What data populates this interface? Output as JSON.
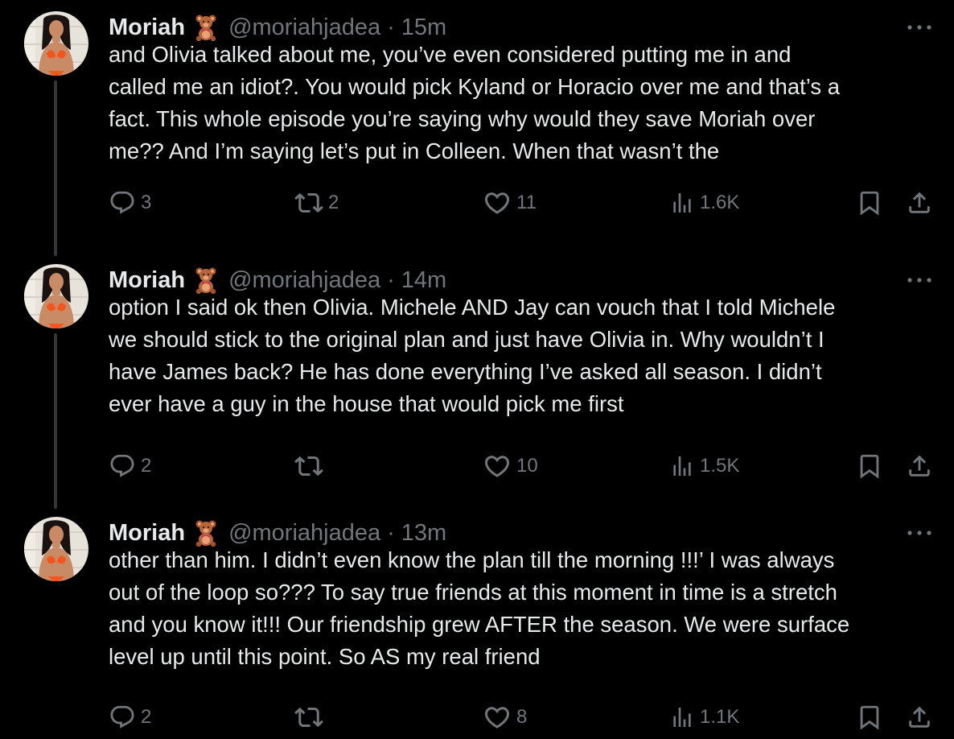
{
  "tweets": [
    {
      "name": "Moriah",
      "handle": "@moriahjadea",
      "separator": "·",
      "time": "15m",
      "text": "and Olivia talked about me, you’ve even considered putting me in and\ncalled me an idiot?. You would pick Kyland or Horacio over me and that’s a\nfact. This whole episode you’re saying why would they save Moriah over\nme?? And I’m saying let’s put in Colleen. When that wasn’t the",
      "replies": "3",
      "reposts": "2",
      "likes": "11",
      "views": "1.6K"
    },
    {
      "name": "Moriah",
      "handle": "@moriahjadea",
      "separator": "·",
      "time": "14m",
      "text": "option I said ok then Olivia. Michele AND Jay can vouch that I told Michele\nwe should stick to the original plan and just have Olivia in. Why wouldn’t I\nhave James back? He has done everything I’ve asked all season. I didn’t\never have a guy in the house that would pick me first",
      "replies": "2",
      "reposts": "",
      "likes": "10",
      "views": "1.5K"
    },
    {
      "name": "Moriah",
      "handle": "@moriahjadea",
      "separator": "·",
      "time": "13m",
      "text": "other than him. I didn’t even know the plan till the morning !!!’ I was always\nout of the loop so??? To say true friends at this moment in time is a stretch\nand you know it!!! Our friendship grew AFTER the season. We were surface\nlevel up until this point. So AS my real friend",
      "replies": "2",
      "reposts": "",
      "likes": "8",
      "views": "1.1K"
    }
  ],
  "icons": {
    "name_emoji": "teddy-bear-icon",
    "more": "more-options-icon",
    "reply": "reply-icon",
    "repost": "repost-icon",
    "like": "like-icon",
    "views": "views-icon",
    "bookmark": "bookmark-icon",
    "share": "share-icon"
  },
  "colors": {
    "background": "#000000",
    "text_primary": "#e7e9ea",
    "text_secondary": "#71767b",
    "thread_line": "#333639"
  }
}
